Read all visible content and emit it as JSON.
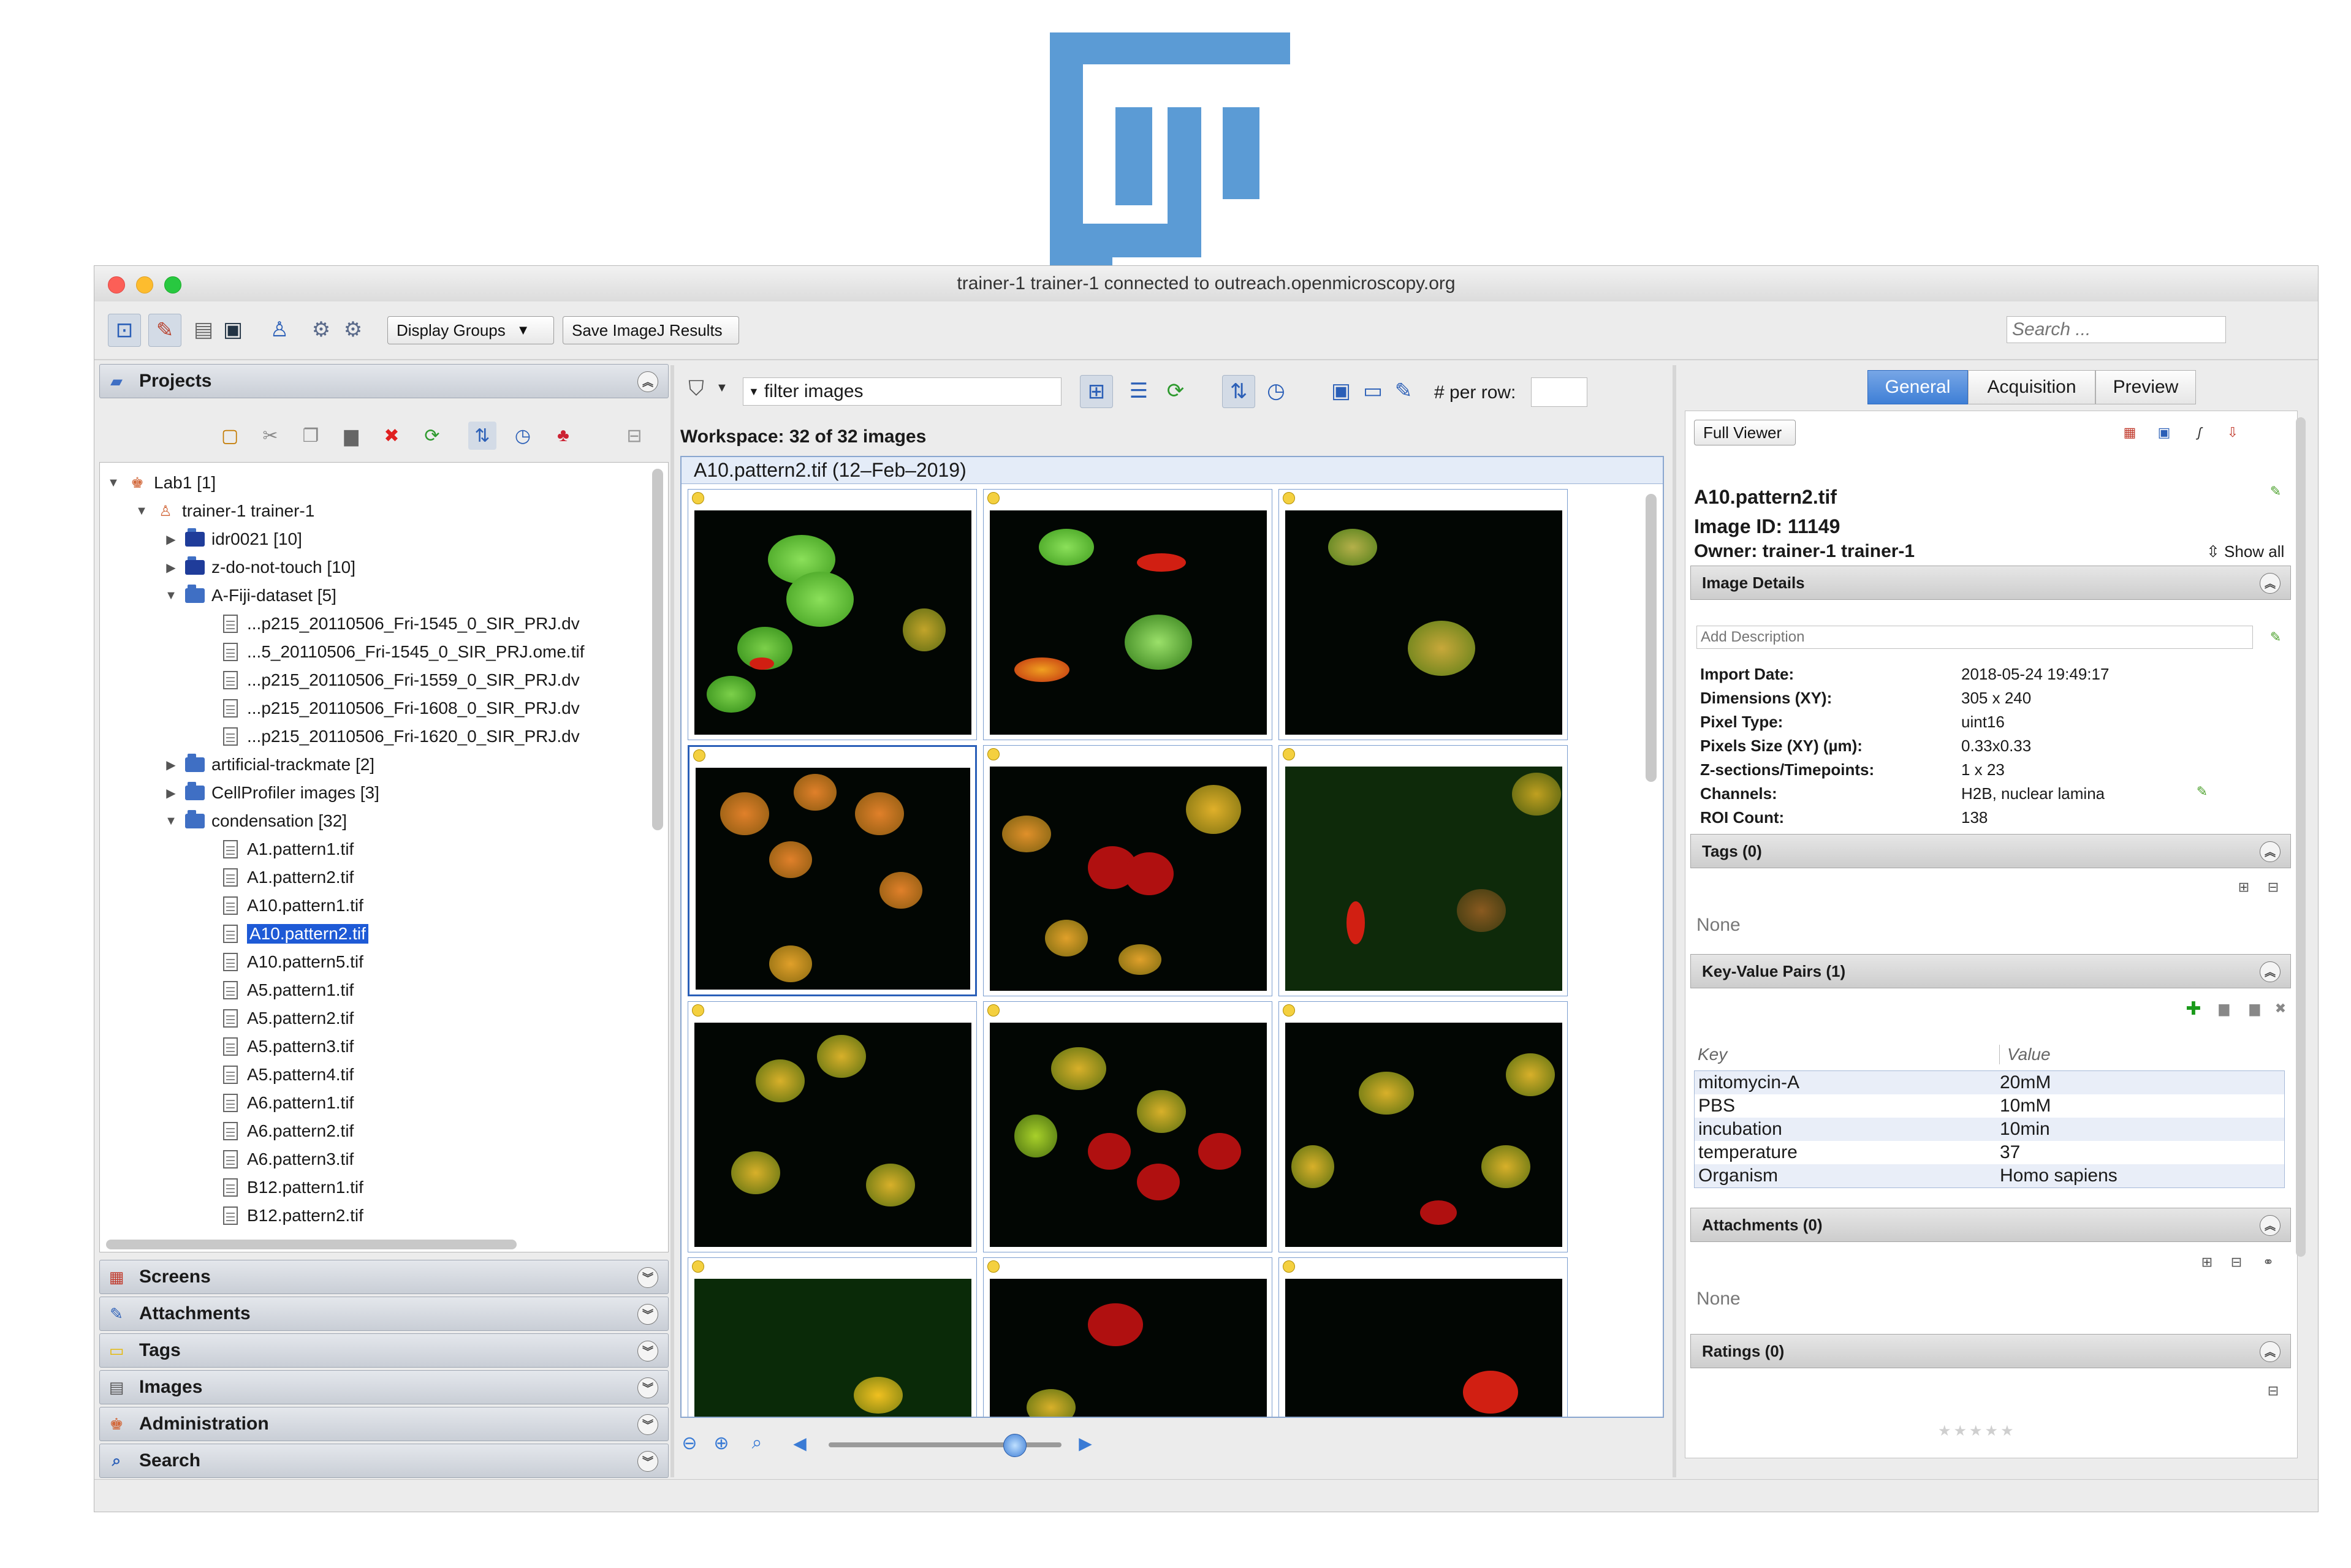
{
  "window": {
    "title": "trainer-1 trainer-1 connected to outreach.openmicroscopy.org"
  },
  "toolbar": {
    "display_groups_label": "Display Groups",
    "save_imagej_label": "Save ImageJ Results",
    "search_placeholder": "Search ..."
  },
  "left_panel": {
    "header": "Projects",
    "tree": [
      {
        "label": "Lab1 [1]",
        "icon": "group-icon",
        "level": 0,
        "expanded": true
      },
      {
        "label": "trainer-1 trainer-1",
        "icon": "user-icon",
        "level": 1,
        "expanded": true
      },
      {
        "label": "idr0021 [10]",
        "icon": "project-icon",
        "level": 2,
        "expanded": false
      },
      {
        "label": "z-do-not-touch [10]",
        "icon": "project-icon",
        "level": 2,
        "expanded": false
      },
      {
        "label": "A-Fiji-dataset [5]",
        "icon": "dataset-icon",
        "level": 2,
        "expanded": true
      },
      {
        "label": "...p215_20110506_Fri-1545_0_SIR_PRJ.dv",
        "icon": "image-icon",
        "level": 3
      },
      {
        "label": "...5_20110506_Fri-1545_0_SIR_PRJ.ome.tif",
        "icon": "image-icon",
        "level": 3
      },
      {
        "label": "...p215_20110506_Fri-1559_0_SIR_PRJ.dv",
        "icon": "image-icon",
        "level": 3
      },
      {
        "label": "...p215_20110506_Fri-1608_0_SIR_PRJ.dv",
        "icon": "image-icon",
        "level": 3
      },
      {
        "label": "...p215_20110506_Fri-1620_0_SIR_PRJ.dv",
        "icon": "image-icon",
        "level": 3
      },
      {
        "label": "artificial-trackmate [2]",
        "icon": "dataset-icon",
        "level": 2,
        "expanded": false
      },
      {
        "label": "CellProfiler images [3]",
        "icon": "dataset-icon",
        "level": 2,
        "expanded": false
      },
      {
        "label": "condensation [32]",
        "icon": "dataset-icon",
        "level": 2,
        "expanded": true
      },
      {
        "label": "A1.pattern1.tif",
        "icon": "image-icon",
        "level": 3
      },
      {
        "label": "A1.pattern2.tif",
        "icon": "image-icon",
        "level": 3
      },
      {
        "label": "A10.pattern1.tif",
        "icon": "image-icon",
        "level": 3
      },
      {
        "label": "A10.pattern2.tif",
        "icon": "image-icon",
        "level": 3,
        "selected": true
      },
      {
        "label": "A10.pattern5.tif",
        "icon": "image-icon",
        "level": 3
      },
      {
        "label": "A5.pattern1.tif",
        "icon": "image-icon",
        "level": 3
      },
      {
        "label": "A5.pattern2.tif",
        "icon": "image-icon",
        "level": 3
      },
      {
        "label": "A5.pattern3.tif",
        "icon": "image-icon",
        "level": 3
      },
      {
        "label": "A5.pattern4.tif",
        "icon": "image-icon",
        "level": 3
      },
      {
        "label": "A6.pattern1.tif",
        "icon": "image-icon",
        "level": 3
      },
      {
        "label": "A6.pattern2.tif",
        "icon": "image-icon",
        "level": 3
      },
      {
        "label": "A6.pattern3.tif",
        "icon": "image-icon",
        "level": 3
      },
      {
        "label": "B12.pattern1.tif",
        "icon": "image-icon",
        "level": 3
      },
      {
        "label": "B12.pattern2.tif",
        "icon": "image-icon",
        "level": 3
      }
    ],
    "accordions": [
      {
        "label": "Screens",
        "icon": "screens-icon"
      },
      {
        "label": "Attachments",
        "icon": "attachments-icon"
      },
      {
        "label": "Tags",
        "icon": "tags-icon"
      },
      {
        "label": "Images",
        "icon": "images-icon"
      },
      {
        "label": "Administration",
        "icon": "administration-icon"
      },
      {
        "label": "Search",
        "icon": "search-icon"
      }
    ]
  },
  "center_panel": {
    "filter_value": "filter  images",
    "per_row_label": "# per row:",
    "workspace_label": "Workspace: 32 of 32 images",
    "grid_title": "A10.pattern2.tif (12–Feb–2019)",
    "zoom_level": 0.8
  },
  "right_panel": {
    "tabs": [
      "General",
      "Acquisition",
      "Preview"
    ],
    "active_tab": "General",
    "full_viewer_label": "Full Viewer",
    "image_name": "A10.pattern2.tif",
    "image_id": "Image ID: 11149",
    "owner": "Owner: trainer-1 trainer-1",
    "show_all": "Show all",
    "image_details_header": "Image Details",
    "description_placeholder": "Add Description",
    "details": [
      {
        "label": "Import Date:",
        "value": "2018-05-24 19:49:17"
      },
      {
        "label": "Dimensions (XY):",
        "value": "305 x 240"
      },
      {
        "label": "Pixel Type:",
        "value": "uint16"
      },
      {
        "label": "Pixels Size (XY) (µm):",
        "value": "0.33x0.33"
      },
      {
        "label": "Z-sections/Timepoints:",
        "value": "1 x 23"
      },
      {
        "label": "Channels:",
        "value": "H2B, nuclear lamina"
      },
      {
        "label": "ROI Count:",
        "value": "138"
      }
    ],
    "tags_header": "Tags (0)",
    "tags_none": "None",
    "kv_header": "Key-Value Pairs (1)",
    "kv_key_col": "Key",
    "kv_value_col": "Value",
    "kv_pairs": [
      {
        "key": "mitomycin-A",
        "value": "20mM"
      },
      {
        "key": "PBS",
        "value": "10mM"
      },
      {
        "key": "incubation",
        "value": "10min"
      },
      {
        "key": "temperature",
        "value": "37"
      },
      {
        "key": "Organism",
        "value": "Homo sapiens"
      }
    ],
    "attachments_header": "Attachments (0)",
    "attachments_none": "None",
    "ratings_header": "Ratings (0)"
  },
  "colors": {
    "logo_blue": "#5b9bd5",
    "selection_blue": "#1e5ad6",
    "tab_active": "#3e7fd6",
    "nucleus_green": "#5bbf2e",
    "nucleus_red": "#d11f12"
  }
}
